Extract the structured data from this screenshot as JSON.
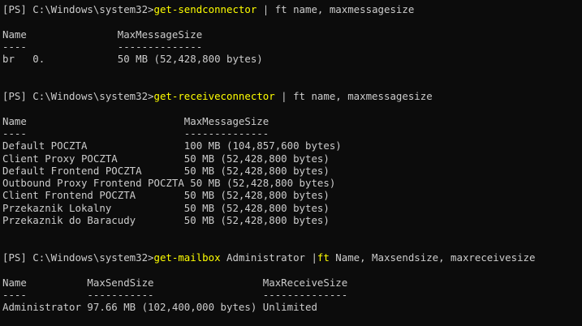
{
  "console": {
    "theme": {
      "background": "#0c0c0c",
      "foreground": "#cccccc",
      "command": "#ffff00"
    },
    "blocks": [
      {
        "prompt": "[PS] C:\\Windows\\system32>",
        "command": "get-sendconnector",
        "args": " | ft name, maxmessagesize",
        "header": "Name               MaxMessageSize",
        "underline": "----               --------------",
        "rows": [
          "br   0.            50 MB (52,428,800 bytes)"
        ]
      },
      {
        "prompt": "[PS] C:\\Windows\\system32>",
        "command": "get-receiveconnector",
        "args": " | ft name, maxmessagesize",
        "header": "Name                          MaxMessageSize",
        "underline": "----                          --------------",
        "rows": [
          "Default POCZTA                100 MB (104,857,600 bytes)",
          "Client Proxy POCZTA           50 MB (52,428,800 bytes)",
          "Default Frontend POCZTA       50 MB (52,428,800 bytes)",
          "Outbound Proxy Frontend POCZTA 50 MB (52,428,800 bytes)",
          "Client Frontend POCZTA        50 MB (52,428,800 bytes)",
          "Przekaznik Lokalny            50 MB (52,428,800 bytes)",
          "Przekaznik do Baracudy        50 MB (52,428,800 bytes)"
        ]
      },
      {
        "prompt": "[PS] C:\\Windows\\system32>",
        "command": "get-mailbox",
        "args": " Administrator |",
        "command2": "ft",
        "args2": " Name, Maxsendsize, maxreceivesize",
        "header": "Name          MaxSendSize                  MaxReceiveSize",
        "underline": "----          -----------                  --------------",
        "rows": [
          "Administrator 97.66 MB (102,400,000 bytes) Unlimited"
        ]
      }
    ]
  }
}
